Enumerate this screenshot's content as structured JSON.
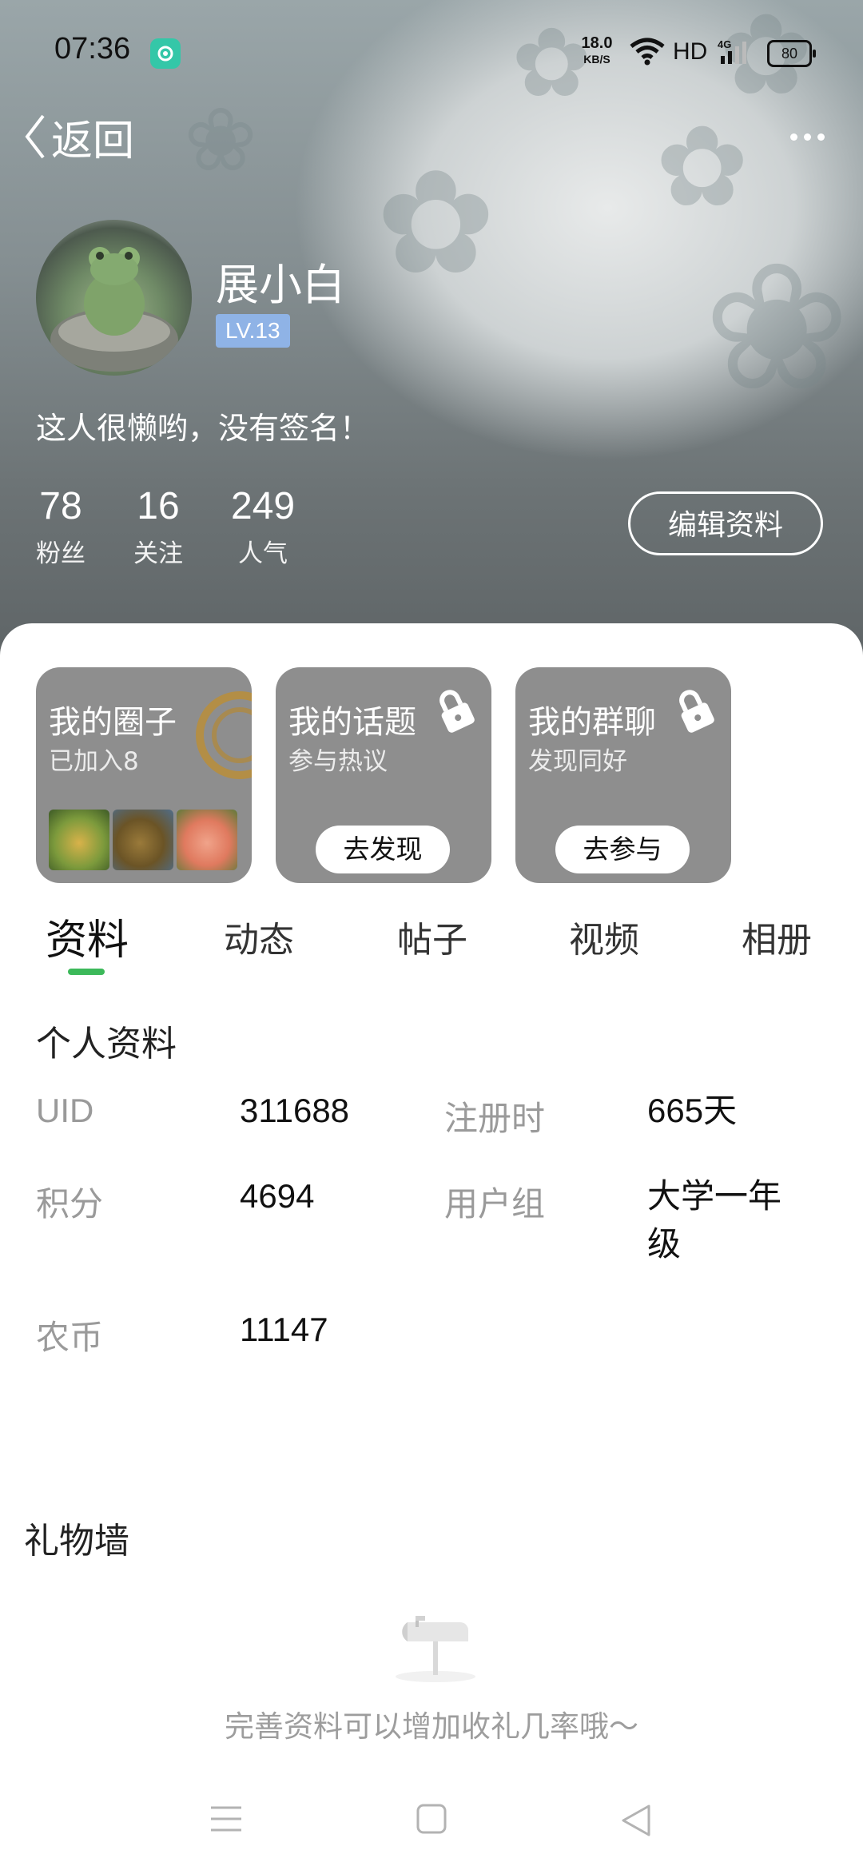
{
  "status_bar": {
    "time": "07:36",
    "net_speed": "18.0",
    "net_speed_unit": "KB/S",
    "hd": "HD",
    "network": "4G",
    "battery": "80"
  },
  "nav": {
    "back_label": "返回",
    "more_icon": "more-icon"
  },
  "profile": {
    "username": "展小白",
    "level": "LV.13",
    "bio": "这人很懒哟，没有签名！",
    "stats": [
      {
        "value": "78",
        "label": "粉丝"
      },
      {
        "value": "16",
        "label": "关注"
      },
      {
        "value": "249",
        "label": "人气"
      }
    ],
    "edit_label": "编辑资料"
  },
  "cards": [
    {
      "title": "我的圈子",
      "subtitle": "已加入8"
    },
    {
      "title": "我的话题",
      "subtitle": "参与热议",
      "button": "去发现"
    },
    {
      "title": "我的群聊",
      "subtitle": "发现同好",
      "button": "去参与"
    }
  ],
  "tabs": [
    "资料",
    "动态",
    "帖子",
    "视频",
    "相册"
  ],
  "info": {
    "title": "个人资料",
    "rows": [
      {
        "label": "UID",
        "value": "311688"
      },
      {
        "label": "注册时",
        "value": "665天"
      },
      {
        "label": "积分",
        "value": "4694"
      },
      {
        "label": "用户组",
        "value": "大学一年级"
      },
      {
        "label": "农币",
        "value": "11147"
      }
    ]
  },
  "gift_wall": {
    "title": "礼物墙",
    "empty_text": "完善资料可以增加收礼几率哦～"
  },
  "colors": {
    "accent": "#3cb95a",
    "level_badge": "#8fb3e6",
    "card_bg": "#8e8e8e"
  }
}
